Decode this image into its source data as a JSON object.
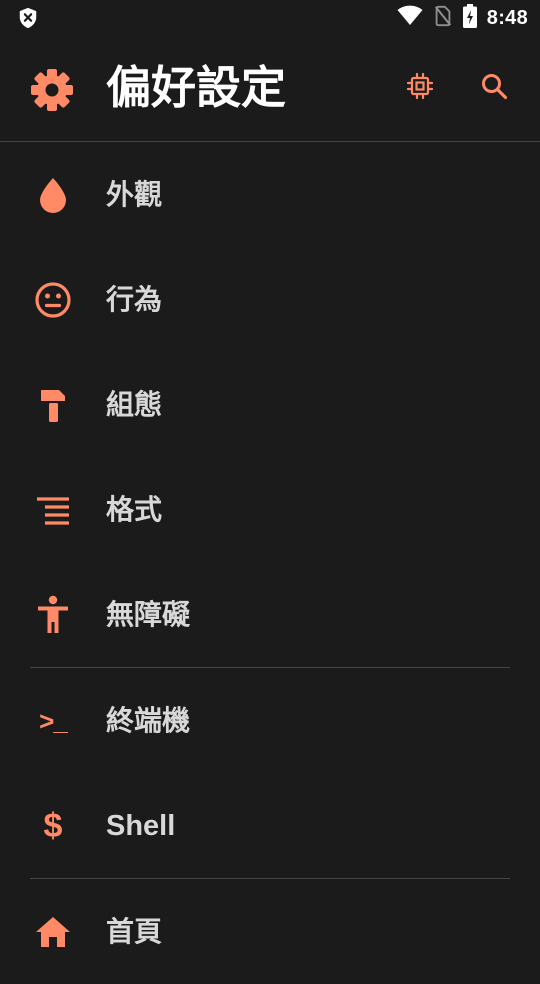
{
  "theme": {
    "accent": "#ff8a65",
    "background": "#1b1b1b",
    "divider": "#444444",
    "title_text": "#ffffff",
    "item_text": "#d8d8d8"
  },
  "status_bar": {
    "left_icon": "shield-x-icon",
    "icons": [
      "wifi-icon",
      "no-sim-icon",
      "battery-charging-icon"
    ],
    "time": "8:48"
  },
  "app_bar": {
    "nav_icon": "gear-icon",
    "title": "偏好設定",
    "actions": [
      "chip-icon",
      "search-icon"
    ]
  },
  "items": [
    {
      "label": "外觀",
      "icon": "water-drop-icon"
    },
    {
      "label": "行為",
      "icon": "neutral-face-icon"
    },
    {
      "label": "組態",
      "icon": "hammer-icon"
    },
    {
      "label": "格式",
      "icon": "format-list-icon"
    },
    {
      "label": "無障礙",
      "icon": "accessibility-icon"
    },
    {
      "label": "終端機",
      "icon": "terminal-icon",
      "glyph": ">_"
    },
    {
      "label": "Shell",
      "icon": "dollar-icon",
      "glyph": "$"
    },
    {
      "label": "首頁",
      "icon": "home-icon"
    }
  ]
}
